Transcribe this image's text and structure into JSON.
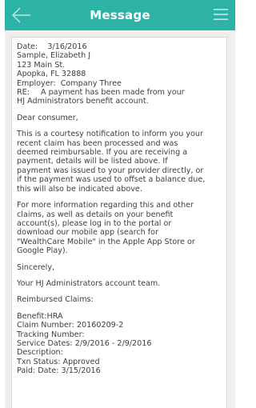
{
  "header": {
    "title": "Message",
    "back_icon": "arrow-left-icon",
    "menu_icon": "hamburger-menu-icon",
    "bar_color": "#2db3a6"
  },
  "message": {
    "date_label": "Date:",
    "date_value": "3/16/2016",
    "name": "Sample, Elizabeth J",
    "address1": "123 Main St.",
    "address2": "Apopka, FL  32888",
    "employer_label": "Employer:",
    "employer_value": "Company Three",
    "re_label": "RE:",
    "re_value_1": "A payment has been made from your",
    "re_value_2": "HJ Administrators benefit account.",
    "greeting": "Dear consumer,",
    "para1": [
      "This is a courtesy notification to inform you your",
      "recent claim has been processed and was",
      "deemed reimbursable.  If you are receiving a",
      "payment, details will be listed above.  If",
      "payment was issued to your provider directly, or",
      "if the payment was used to offset a balance due,",
      "this will also be indicated above."
    ],
    "para2": [
      "For more information regarding this and other",
      "claims, as well as details on your benefit",
      "account(s), please log in to the portal or",
      "download our mobile app (search for",
      "\"WealthCare Mobile\" in the Apple App Store or",
      "Google Play)."
    ],
    "closing": "Sincerely,",
    "signature": "Your HJ Administrators account team.",
    "reimbursed_heading": "Reimbursed Claims:",
    "claim": [
      "Benefit:HRA",
      "Claim Number: 20160209-2",
      "Tracking Number:",
      "Service Dates: 2/9/2016 - 2/9/2016",
      "Description:",
      "Txn Status: Approved",
      "Paid: Date: 3/15/2016"
    ]
  }
}
